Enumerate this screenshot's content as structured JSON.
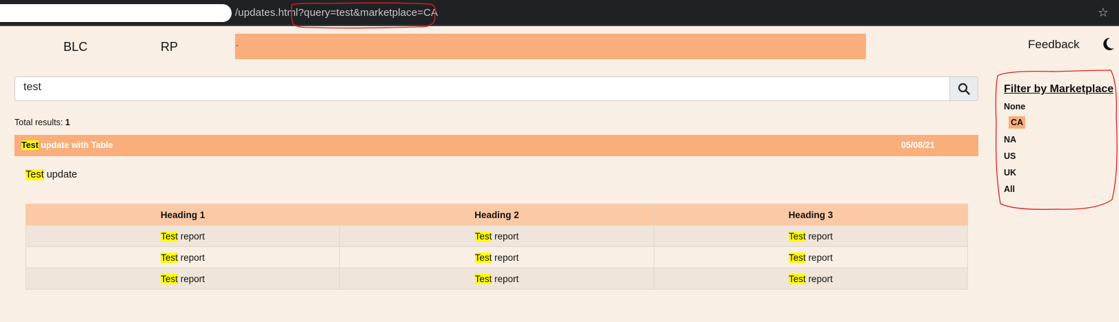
{
  "browser": {
    "url": "/updates.html?query=test&marketplace=CA",
    "star_icon": "star-icon"
  },
  "nav": {
    "blc": "BLC",
    "rp": "RP",
    "feedback": "Feedback",
    "theme_icon": "moon-icon"
  },
  "search": {
    "value": "test",
    "button_icon": "search-icon"
  },
  "results": {
    "total_label": "Total results:",
    "total_count": "1",
    "items": [
      {
        "title_highlight": "Test",
        "title_rest": " update with Table",
        "date": "05/08/21",
        "body_highlight": "Test",
        "body_rest": " update",
        "table": {
          "headers": [
            "Heading 1",
            "Heading 2",
            "Heading 3"
          ],
          "cell_highlight": "Test",
          "cell_rest": " report"
        }
      }
    ]
  },
  "filter": {
    "title": "Filter by Marketplace",
    "options": [
      "None",
      "CA",
      "NA",
      "US",
      "UK",
      "All"
    ],
    "selected": "CA"
  },
  "colors": {
    "accent": "#f9ae7b",
    "background": "#f9efe4",
    "highlight": "#ffff00",
    "annotation": "#e02020"
  }
}
